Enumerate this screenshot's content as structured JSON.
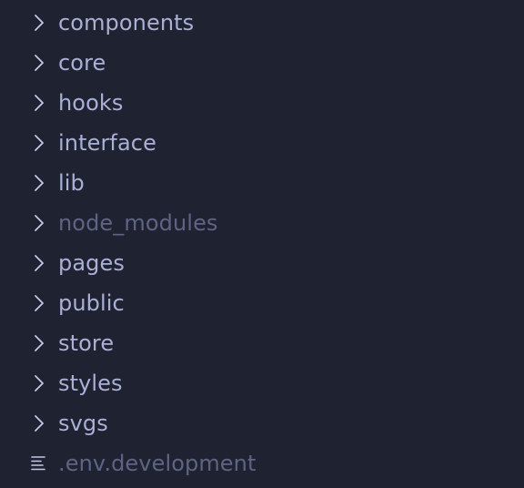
{
  "explorer": {
    "folders": [
      {
        "label": "components",
        "icon": "chevron-right-icon"
      },
      {
        "label": "core",
        "icon": "chevron-right-icon"
      },
      {
        "label": "hooks",
        "icon": "chevron-right-icon"
      },
      {
        "label": "interface",
        "icon": "chevron-right-icon"
      },
      {
        "label": "lib",
        "icon": "chevron-right-icon"
      },
      {
        "label": "node_modules",
        "icon": "chevron-right-icon"
      },
      {
        "label": "pages",
        "icon": "chevron-right-icon"
      },
      {
        "label": "public",
        "icon": "chevron-right-icon"
      },
      {
        "label": "store",
        "icon": "chevron-right-icon"
      },
      {
        "label": "styles",
        "icon": "chevron-right-icon"
      },
      {
        "label": "svgs",
        "icon": "chevron-right-icon"
      }
    ],
    "files": [
      {
        "label": ".env.development",
        "icon": "text-file-icon"
      }
    ]
  },
  "colors": {
    "background": "#1f2230",
    "text": "#aab0d6",
    "dimmed_text": "#5e6483",
    "icon": "#c3c8e6"
  }
}
